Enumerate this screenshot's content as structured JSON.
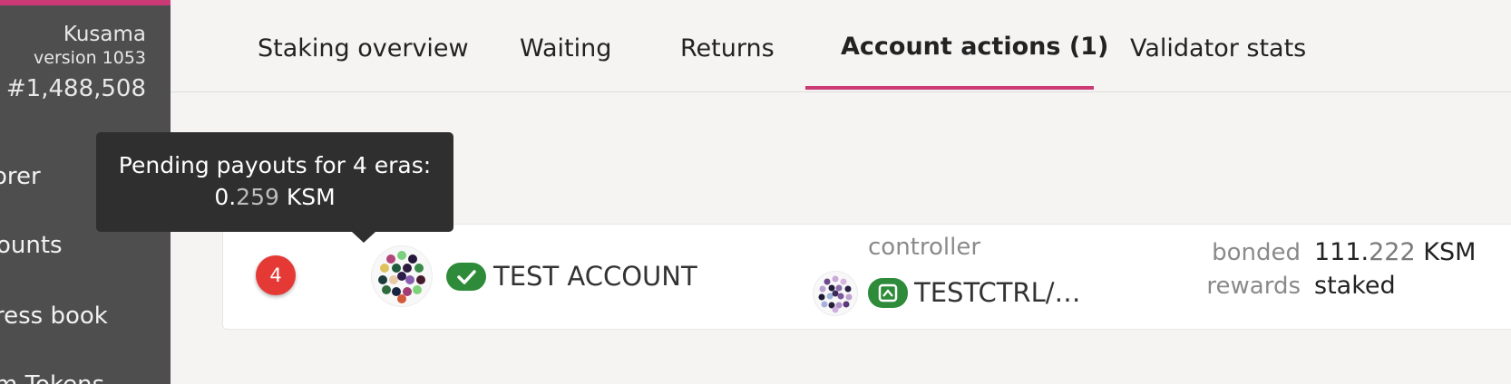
{
  "sidebar": {
    "chain_name": "Kusama",
    "version": "version 1053",
    "block": "#1,488,508",
    "nav": [
      "orer",
      "ounts",
      "ress book",
      "m Tokens"
    ]
  },
  "tabs": [
    {
      "label": "Staking overview",
      "active": false
    },
    {
      "label": "Waiting",
      "active": false
    },
    {
      "label": "Returns",
      "active": false
    },
    {
      "label": "Account actions (1)",
      "active": true
    },
    {
      "label": "Validator stats",
      "active": false
    }
  ],
  "tooltip": {
    "line1": "Pending payouts for 4 eras:",
    "amount_int": "0.",
    "amount_dec": "259",
    "unit": "KSM"
  },
  "account": {
    "payout_count": "4",
    "name": "TEST ACCOUNT",
    "controller_label": "controller",
    "controller_name": "TESTCTRL/…",
    "bonded_label": "bonded",
    "bonded_int": "111.",
    "bonded_dec": "222",
    "bonded_unit": "KSM",
    "rewards_label": "rewards",
    "rewards_value": "staked"
  },
  "colors": {
    "accent": "#cc3a76",
    "sidebar": "#4e4e4e",
    "badge": "#e53935",
    "identity_green": "#2e8b3a"
  },
  "icons": [
    "check-icon",
    "shield-icon",
    "identicon"
  ]
}
